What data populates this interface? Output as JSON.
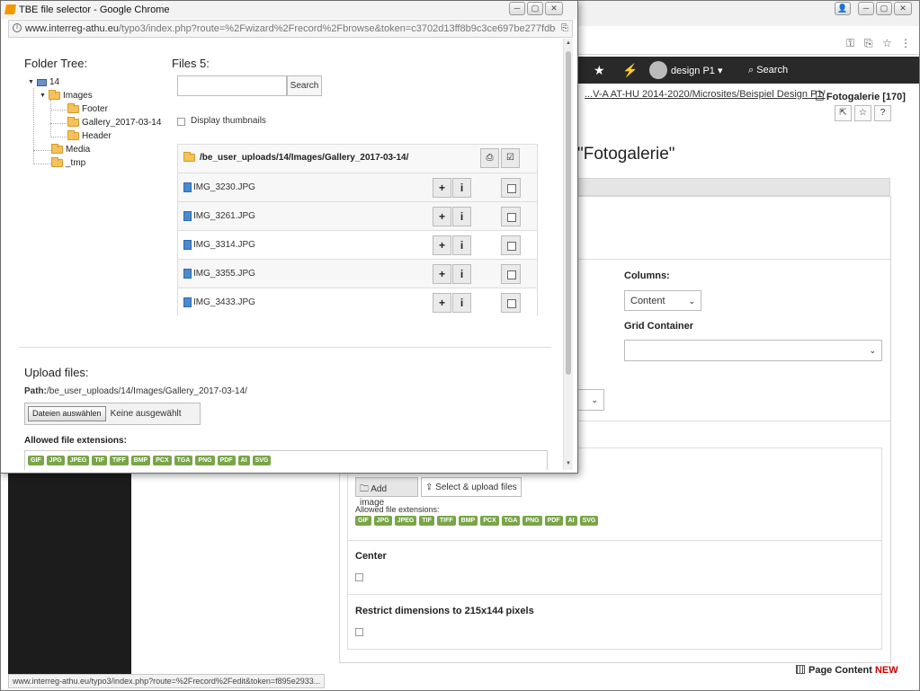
{
  "popup": {
    "title": "TBE file selector - Google Chrome",
    "url_host": "www.interreg-athu.eu",
    "url_path": "/typo3/index.php?route=%2Fwizard%2Frecord%2Fbrowse&token=c3702d13ff8b9c3ce697be277fdbcf0a5c188...",
    "folder_tree": {
      "title": "Folder Tree:",
      "items": [
        {
          "label": "14"
        },
        {
          "label": "Images"
        },
        {
          "label": "Footer"
        },
        {
          "label": "Gallery_2017-03-14"
        },
        {
          "label": "Header"
        },
        {
          "label": "Media"
        },
        {
          "label": "_tmp"
        }
      ]
    },
    "files": {
      "title": "Files 5:",
      "search_placeholder": "",
      "search_label": "Search",
      "display_thumbnails": "Display thumbnails",
      "current_path": "/be_user_uploads/14/Images/Gallery_2017-03-14/",
      "rows": [
        {
          "name": "IMG_3230.JPG"
        },
        {
          "name": "IMG_3261.JPG"
        },
        {
          "name": "IMG_3314.JPG"
        },
        {
          "name": "IMG_3355.JPG"
        },
        {
          "name": "IMG_3433.JPG"
        }
      ],
      "add_symbol": "+",
      "info_symbol": "i"
    },
    "upload": {
      "title": "Upload files:",
      "path_label": "Path:",
      "path_value": "/be_user_uploads/14/Images/Gallery_2017-03-14/",
      "choose_button": "Dateien auswählen",
      "no_file": "Keine ausgewählt",
      "allowed_title": "Allowed file extensions:"
    }
  },
  "extensions": [
    "GIF",
    "JPG",
    "JPEG",
    "TIF",
    "TIFF",
    "BMP",
    "PCX",
    "TGA",
    "PNG",
    "PDF",
    "AI",
    "SVG"
  ],
  "main": {
    "user_name": "design P1",
    "search_label": "Search",
    "breadcrumb_path": "...V-A AT-HU 2014-2020/Microsites/Beispiel Design P1/",
    "breadcrumb_page": "Fotogalerie [170]",
    "page_title": "\"Fotogalerie\"",
    "columns_label": "Columns:",
    "columns_value": "Content",
    "grid_label": "Grid Container",
    "add_image": "Add image",
    "select_upload": "Select & upload files",
    "allowed_ext_label": "Allowed file extensions:",
    "center_label": "Center",
    "restrict_label": "Restrict dimensions to 215x144 pixels",
    "footer_label": "Page Content",
    "footer_new": "NEW",
    "status_url": "www.interreg-athu.eu/typo3/index.php?route=%2Frecord%2Fedit&token=f895e2933..."
  },
  "colors": {
    "badge_green": "#79a548",
    "topbar_dark": "#292929",
    "new_red": "#cc0000"
  }
}
